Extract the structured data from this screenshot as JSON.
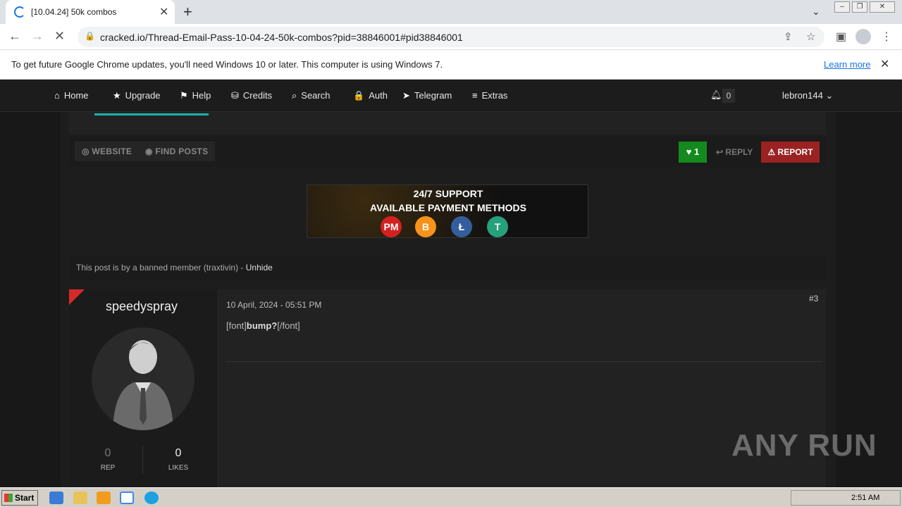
{
  "browser": {
    "tab_title": "[10.04.24] 50k combos",
    "url": "cracked.io/Thread-Email-Pass-10-04-24-50k-combos?pid=38846001#pid38846001",
    "infobar_message": "To get future Google Chrome updates, you'll need Windows 10 or later. This computer is using Windows 7.",
    "infobar_link": "Learn more"
  },
  "nav": {
    "items": [
      {
        "label": "Home",
        "icon": "home-icon"
      },
      {
        "label": "Upgrade",
        "icon": "star-icon"
      },
      {
        "label": "Help",
        "icon": "flag-icon"
      },
      {
        "label": "Credits",
        "icon": "coins-icon"
      },
      {
        "label": "Search",
        "icon": "search-icon"
      },
      {
        "label": "Auth",
        "icon": "lock-icon"
      },
      {
        "label": "Telegram",
        "icon": "telegram-icon"
      },
      {
        "label": "Extras",
        "icon": "menu-icon"
      }
    ],
    "notifications": "0",
    "username": "lebron144"
  },
  "actions": {
    "website": "WEBSITE",
    "find_posts": "FIND POSTS",
    "likes": "1",
    "reply": "REPLY",
    "report": "REPORT"
  },
  "banner": {
    "line1": "24/7 SUPPORT",
    "line2": "AVAILABLE PAYMENT METHODS",
    "coins": [
      "PM",
      "B",
      "Ł",
      "T"
    ],
    "coin_colors": [
      "#d42020",
      "#f7931a",
      "#345d9d",
      "#26a17b"
    ]
  },
  "banned_notice": {
    "text": "This post is by a banned member (traxtivin) - ",
    "link": "Unhide"
  },
  "post": {
    "username": "speedyspray",
    "rep": "0",
    "rep_label": "REP",
    "likes": "0",
    "likes_label": "LIKES",
    "date": "10 April, 2024 - 05:51 PM",
    "number": "#3",
    "text_open": "[font]",
    "text_bold": "bump?",
    "text_close": "[/font]"
  },
  "watermark": "ANY RUN",
  "taskbar": {
    "start": "Start",
    "clock": "2:51 AM"
  }
}
